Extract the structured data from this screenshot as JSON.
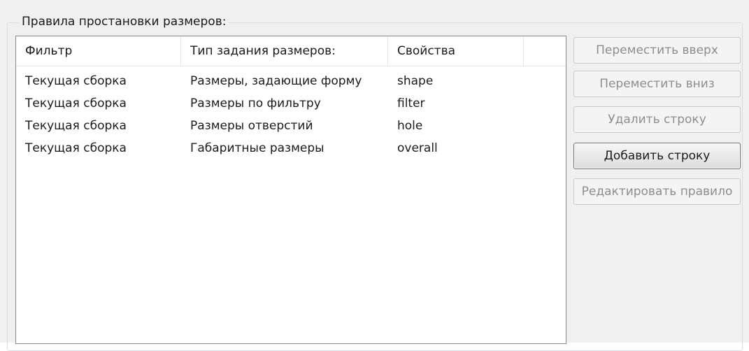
{
  "group": {
    "title": "Правила простановки размеров:"
  },
  "table": {
    "columns": [
      "Фильтр",
      "Тип задания размеров:",
      "Свойства",
      ""
    ],
    "rows": [
      [
        "Текущая сборка",
        "Размеры, задающие форму",
        "shape"
      ],
      [
        "Текущая сборка",
        "Размеры по фильтру",
        "filter"
      ],
      [
        "Текущая сборка",
        "Размеры отверстий",
        "hole"
      ],
      [
        "Текущая сборка",
        "Габаритные размеры",
        "overall"
      ]
    ]
  },
  "buttons": {
    "move_up": {
      "label": "Переместить вверх",
      "enabled": false
    },
    "move_down": {
      "label": "Переместить вниз",
      "enabled": false
    },
    "delete_row": {
      "label": "Удалить строку",
      "enabled": false
    },
    "add_row": {
      "label": "Добавить строку",
      "enabled": true
    },
    "edit_rule": {
      "label": "Редактировать правило",
      "enabled": false
    }
  }
}
